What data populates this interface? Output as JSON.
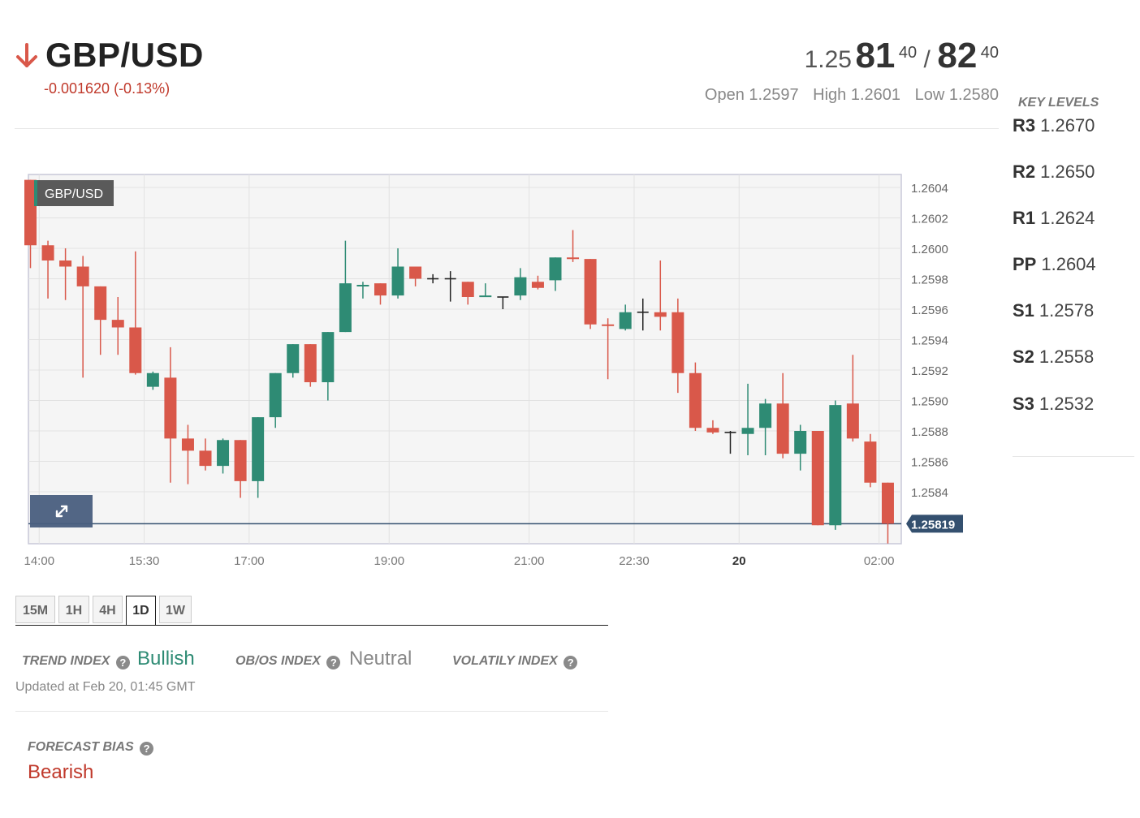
{
  "header": {
    "pair": "GBP/USD",
    "direction_icon": "arrow-down-icon",
    "change": "-0.001620 (-0.13%)",
    "quote": {
      "bid_prefix": "1.25",
      "bid_big": "81",
      "bid_pip": "40",
      "separator": "/",
      "ask_big": "82",
      "ask_pip": "40"
    },
    "open": "Open 1.2597",
    "high": "High 1.2601",
    "low": "Low 1.2580"
  },
  "key_levels": {
    "title": "KEY LEVELS",
    "items": [
      {
        "name": "R3",
        "value": "1.2670"
      },
      {
        "name": "R2",
        "value": "1.2650"
      },
      {
        "name": "R1",
        "value": "1.2624"
      },
      {
        "name": "PP",
        "value": "1.2604"
      },
      {
        "name": "S1",
        "value": "1.2578"
      },
      {
        "name": "S2",
        "value": "1.2558"
      },
      {
        "name": "S3",
        "value": "1.2532"
      }
    ]
  },
  "chart_data": {
    "type": "candlestick",
    "symbol_label": "GBP/USD",
    "last_price_label": "1.25819",
    "last_price": 1.25819,
    "ylim": [
      1.258,
      1.2605
    ],
    "y_ticks": [
      "1.2604",
      "1.2602",
      "1.2600",
      "1.2598",
      "1.2596",
      "1.2594",
      "1.2592",
      "1.2590",
      "1.2588",
      "1.2586",
      "1.2584"
    ],
    "x_ticks": [
      {
        "label": "14:00",
        "index": 0.5,
        "bold": false
      },
      {
        "label": "15:30",
        "index": 6.5,
        "bold": false
      },
      {
        "label": "17:00",
        "index": 12.5,
        "bold": false
      },
      {
        "label": "19:00",
        "index": 20.5,
        "bold": false
      },
      {
        "label": "21:00",
        "index": 28.5,
        "bold": false
      },
      {
        "label": "22:30",
        "index": 34.5,
        "bold": false
      },
      {
        "label": "20",
        "index": 40.5,
        "bold": true
      },
      {
        "label": "02:00",
        "index": 48.5,
        "bold": false
      }
    ],
    "colors": {
      "up": "#2e8b74",
      "down": "#d9584a",
      "neutral": "#222222",
      "price_line": "#34506f"
    },
    "candles": [
      {
        "o": 1.26045,
        "h": 1.26045,
        "c": 1.26002,
        "l": 1.25987
      },
      {
        "o": 1.26002,
        "h": 1.26005,
        "c": 1.25992,
        "l": 1.25967
      },
      {
        "o": 1.25992,
        "h": 1.26,
        "c": 1.25988,
        "l": 1.25966
      },
      {
        "o": 1.25988,
        "h": 1.25995,
        "c": 1.25975,
        "l": 1.25915
      },
      {
        "o": 1.25975,
        "h": 1.25975,
        "c": 1.25953,
        "l": 1.2593
      },
      {
        "o": 1.25953,
        "h": 1.25968,
        "c": 1.25948,
        "l": 1.2593
      },
      {
        "o": 1.25948,
        "h": 1.25998,
        "c": 1.25918,
        "l": 1.25917
      },
      {
        "o": 1.25909,
        "h": 1.25919,
        "c": 1.25918,
        "l": 1.25907
      },
      {
        "o": 1.25915,
        "h": 1.25935,
        "c": 1.25875,
        "l": 1.25846
      },
      {
        "o": 1.25875,
        "h": 1.25884,
        "c": 1.25867,
        "l": 1.25845
      },
      {
        "o": 1.25867,
        "h": 1.25875,
        "c": 1.25857,
        "l": 1.25854
      },
      {
        "o": 1.25857,
        "h": 1.25875,
        "c": 1.25874,
        "l": 1.25852
      },
      {
        "o": 1.25874,
        "h": 1.25874,
        "c": 1.25847,
        "l": 1.25836
      },
      {
        "o": 1.25847,
        "h": 1.25889,
        "c": 1.25889,
        "l": 1.25836
      },
      {
        "o": 1.25889,
        "h": 1.25918,
        "c": 1.25918,
        "l": 1.25882
      },
      {
        "o": 1.25918,
        "h": 1.25937,
        "c": 1.25937,
        "l": 1.25915
      },
      {
        "o": 1.25937,
        "h": 1.25937,
        "c": 1.25912,
        "l": 1.25909
      },
      {
        "o": 1.25912,
        "h": 1.25945,
        "c": 1.25945,
        "l": 1.259
      },
      {
        "o": 1.25945,
        "h": 1.26005,
        "c": 1.25977,
        "l": 1.25945
      },
      {
        "o": 1.25975,
        "h": 1.25978,
        "c": 1.25976,
        "l": 1.25967
      },
      {
        "o": 1.25977,
        "h": 1.25977,
        "c": 1.25969,
        "l": 1.25963
      },
      {
        "o": 1.25969,
        "h": 1.26,
        "c": 1.25988,
        "l": 1.25967
      },
      {
        "o": 1.25988,
        "h": 1.25988,
        "c": 1.2598,
        "l": 1.25975
      },
      {
        "o": 1.2598,
        "h": 1.25983,
        "c": 1.2598,
        "l": 1.25977
      },
      {
        "o": 1.2598,
        "h": 1.25985,
        "c": 1.2598,
        "l": 1.25965
      },
      {
        "o": 1.25978,
        "h": 1.25978,
        "c": 1.25968,
        "l": 1.25963
      },
      {
        "o": 1.25968,
        "h": 1.25977,
        "c": 1.25969,
        "l": 1.25968
      },
      {
        "o": 1.25968,
        "h": 1.25968,
        "c": 1.25968,
        "l": 1.2596
      },
      {
        "o": 1.25969,
        "h": 1.25987,
        "c": 1.25981,
        "l": 1.25966
      },
      {
        "o": 1.25978,
        "h": 1.25982,
        "c": 1.25974,
        "l": 1.25973
      },
      {
        "o": 1.25979,
        "h": 1.25994,
        "c": 1.25994,
        "l": 1.25972
      },
      {
        "o": 1.25994,
        "h": 1.26012,
        "c": 1.25993,
        "l": 1.25991
      },
      {
        "o": 1.25993,
        "h": 1.25993,
        "c": 1.2595,
        "l": 1.25947
      },
      {
        "o": 1.2595,
        "h": 1.25954,
        "c": 1.25949,
        "l": 1.25914
      },
      {
        "o": 1.25947,
        "h": 1.25963,
        "c": 1.25958,
        "l": 1.25946
      },
      {
        "o": 1.25958,
        "h": 1.25967,
        "c": 1.25958,
        "l": 1.25946
      },
      {
        "o": 1.25958,
        "h": 1.25992,
        "c": 1.25955,
        "l": 1.25946
      },
      {
        "o": 1.25958,
        "h": 1.25967,
        "c": 1.25918,
        "l": 1.25905
      },
      {
        "o": 1.25918,
        "h": 1.25925,
        "c": 1.25882,
        "l": 1.2588
      },
      {
        "o": 1.25882,
        "h": 1.25887,
        "c": 1.25879,
        "l": 1.25878
      },
      {
        "o": 1.25879,
        "h": 1.2588,
        "c": 1.25879,
        "l": 1.25865
      },
      {
        "o": 1.25878,
        "h": 1.25911,
        "c": 1.25882,
        "l": 1.25864
      },
      {
        "o": 1.25882,
        "h": 1.25901,
        "c": 1.25898,
        "l": 1.25864
      },
      {
        "o": 1.25898,
        "h": 1.25918,
        "c": 1.25865,
        "l": 1.25862
      },
      {
        "o": 1.25865,
        "h": 1.25884,
        "c": 1.2588,
        "l": 1.25854
      },
      {
        "o": 1.2588,
        "h": 1.2588,
        "c": 1.25818,
        "l": 1.25818
      },
      {
        "o": 1.25818,
        "h": 1.259,
        "c": 1.25897,
        "l": 1.25815
      },
      {
        "o": 1.25898,
        "h": 1.2593,
        "c": 1.25875,
        "l": 1.25873
      },
      {
        "o": 1.25873,
        "h": 1.25878,
        "c": 1.25846,
        "l": 1.25843
      },
      {
        "o": 1.25846,
        "h": 1.25846,
        "c": 1.25819,
        "l": 1.25806
      }
    ]
  },
  "timeframes": {
    "tabs": [
      "15M",
      "1H",
      "4H",
      "1D",
      "1W"
    ],
    "active": "1D"
  },
  "indices": {
    "trend_label": "TREND INDEX",
    "trend_value": "Bullish",
    "obos_label": "OB/OS INDEX",
    "obos_value": "Neutral",
    "volatility_label": "VOLATILY INDEX",
    "help_glyph": "?",
    "updated": "Updated at Feb 20, 01:45 GMT",
    "colors": {
      "bullish": "#2e8b74",
      "neutral": "#888888",
      "bearish": "#c0392b"
    }
  },
  "forecast": {
    "label": "FORECAST BIAS",
    "value": "Bearish"
  }
}
